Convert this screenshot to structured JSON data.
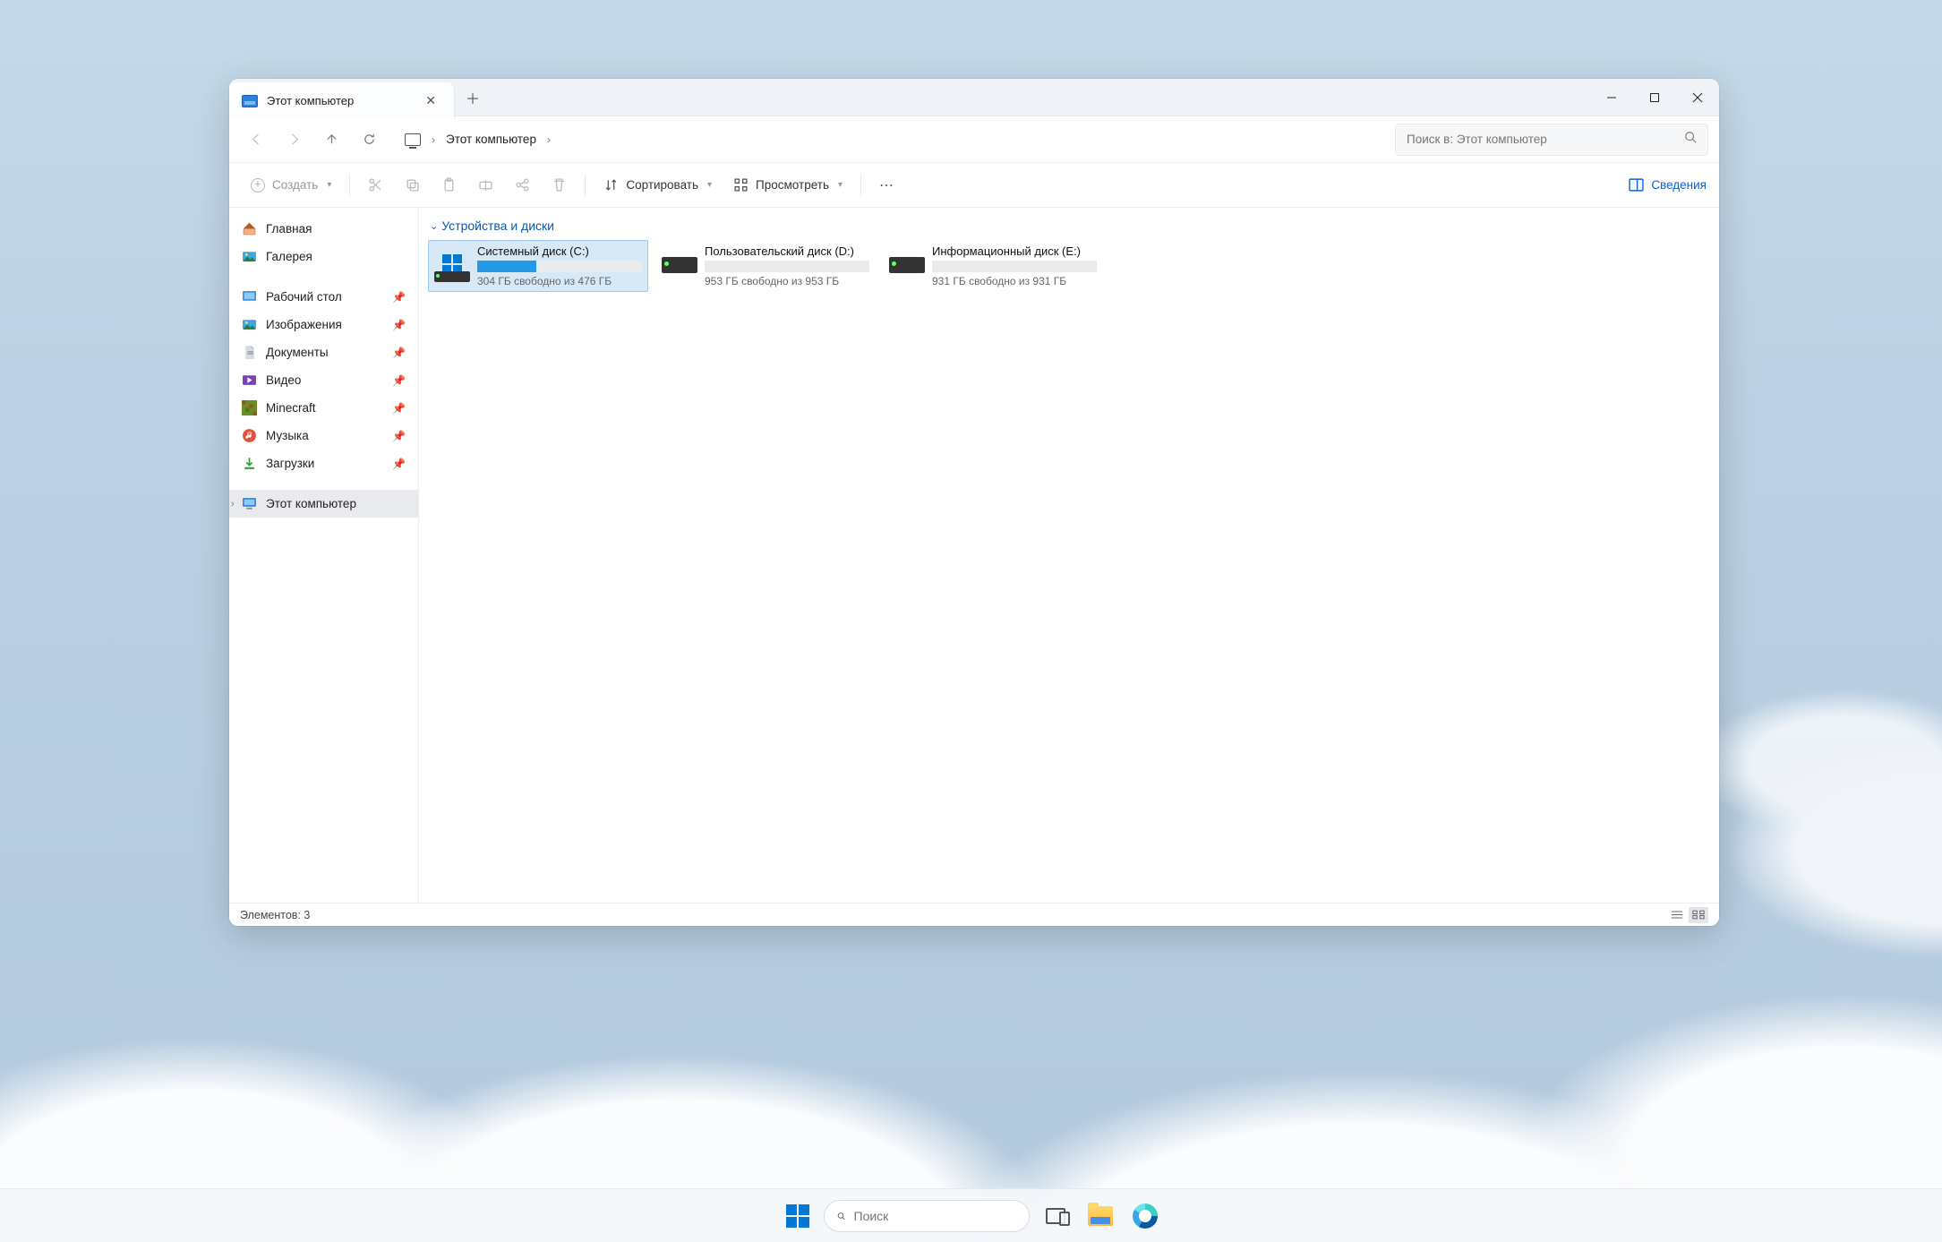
{
  "tab": {
    "title": "Этот компьютер"
  },
  "address": {
    "location": "Этот компьютер"
  },
  "search": {
    "placeholder": "Поиск в: Этот компьютер"
  },
  "toolbar": {
    "create": "Создать",
    "sort": "Сортировать",
    "view": "Просмотреть",
    "details": "Сведения"
  },
  "sidebar": {
    "home": "Главная",
    "gallery": "Галерея",
    "quick": [
      {
        "label": "Рабочий стол"
      },
      {
        "label": "Изображения"
      },
      {
        "label": "Документы"
      },
      {
        "label": "Видео"
      },
      {
        "label": "Minecraft"
      },
      {
        "label": "Музыка"
      },
      {
        "label": "Загрузки"
      }
    ],
    "thispc": "Этот компьютер"
  },
  "section": {
    "title": "Устройства и диски"
  },
  "drives": [
    {
      "name": "Системный диск (C:)",
      "free_text": "304 ГБ свободно из 476 ГБ",
      "used_pct": 36,
      "type": "system",
      "selected": true
    },
    {
      "name": "Пользовательский диск (D:)",
      "free_text": "953 ГБ свободно из 953 ГБ",
      "used_pct": 0,
      "type": "hdd",
      "selected": false
    },
    {
      "name": "Информационный диск (E:)",
      "free_text": "931 ГБ свободно из 931 ГБ",
      "used_pct": 0,
      "type": "hdd",
      "selected": false
    }
  ],
  "statusbar": {
    "items": "Элементов: 3"
  },
  "taskbar": {
    "search_placeholder": "Поиск"
  }
}
